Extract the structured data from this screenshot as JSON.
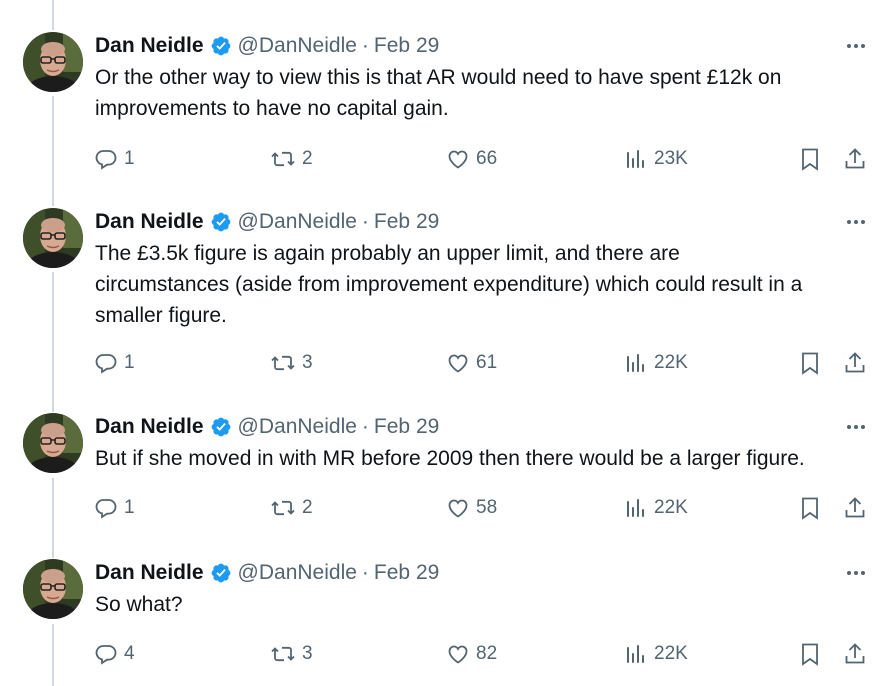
{
  "tweets": [
    {
      "name": "Dan Neidle",
      "handle": "@DanNeidle",
      "dot": "·",
      "date": "Feb 29",
      "lines": [
        "Or the other way to view this is that AR would need to have spent £12k on",
        "improvements to have no capital gain."
      ],
      "replies": "1",
      "retweets": "2",
      "likes": "66",
      "views": "23K"
    },
    {
      "name": "Dan Neidle",
      "handle": "@DanNeidle",
      "dot": "·",
      "date": "Feb 29",
      "lines": [
        "The £3.5k figure is again probably an upper limit, and there are",
        "circumstances (aside from improvement expenditure) which could result in a",
        "smaller figure."
      ],
      "replies": "1",
      "retweets": "3",
      "likes": "61",
      "views": "22K"
    },
    {
      "name": "Dan Neidle",
      "handle": "@DanNeidle",
      "dot": "·",
      "date": "Feb 29",
      "lines": [
        "But if she moved in with MR before 2009 then there would be a larger figure."
      ],
      "replies": "1",
      "retweets": "2",
      "likes": "58",
      "views": "22K"
    },
    {
      "name": "Dan Neidle",
      "handle": "@DanNeidle",
      "dot": "·",
      "date": "Feb 29",
      "lines": [
        "So what?"
      ],
      "replies": "4",
      "retweets": "3",
      "likes": "82",
      "views": "22K"
    }
  ],
  "colors": {
    "text": "#0f1419",
    "muted": "#536471",
    "verified": "#1d9bf0",
    "thread": "#cfd9de"
  }
}
